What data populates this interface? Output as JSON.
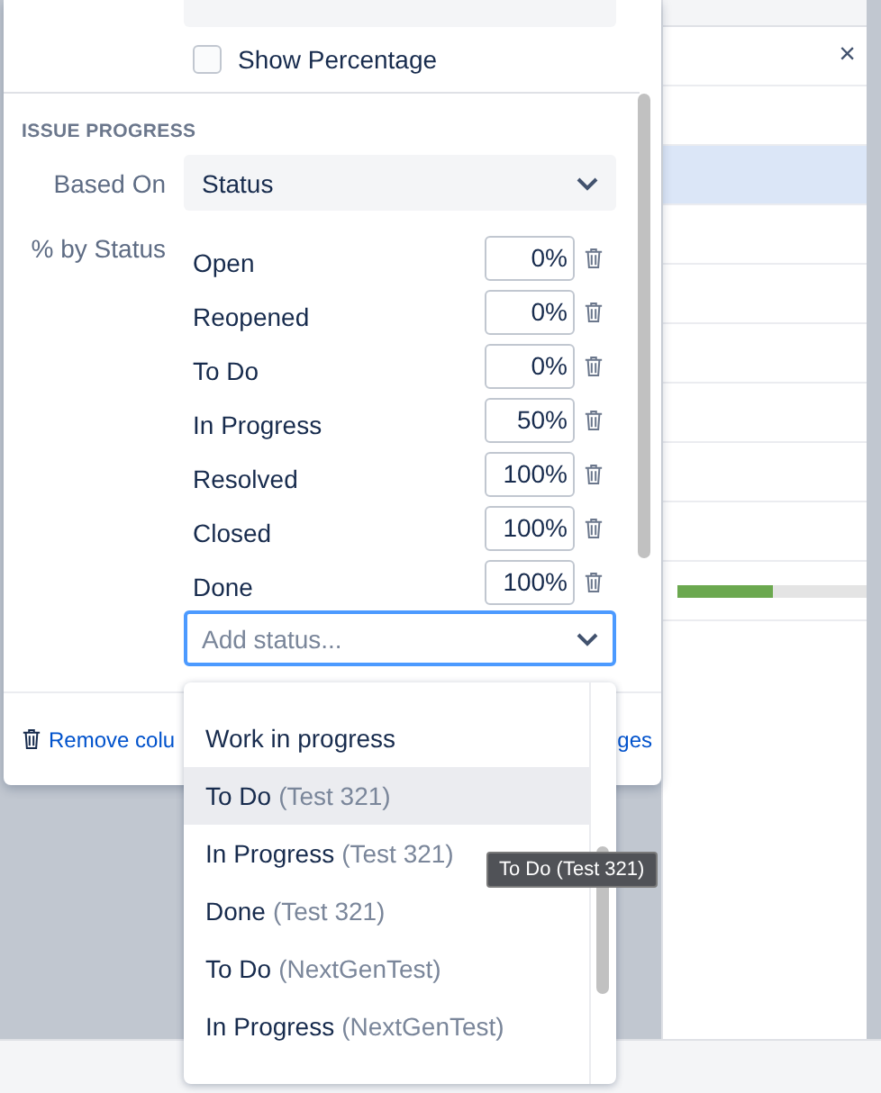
{
  "table": {
    "close_label": "×",
    "rows": [
      {
        "selected": false
      },
      {
        "selected": true
      },
      {
        "selected": false
      },
      {
        "selected": false
      },
      {
        "selected": false
      },
      {
        "selected": false
      },
      {
        "selected": false
      },
      {
        "selected": false
      },
      {
        "selected": false,
        "level": 0.5
      }
    ]
  },
  "panel": {
    "show_percentage": {
      "label": "Show Percentage",
      "checked": false
    },
    "section_title": "ISSUE PROGRESS",
    "based_on": {
      "label": "Based On",
      "value": "Status"
    },
    "by_status": {
      "label": "% by Status",
      "rows": [
        {
          "name": "Open",
          "value": "0%"
        },
        {
          "name": "Reopened",
          "value": "0%"
        },
        {
          "name": "To Do",
          "value": "0%"
        },
        {
          "name": "In Progress",
          "value": "50%"
        },
        {
          "name": "Resolved",
          "value": "100%"
        },
        {
          "name": "Closed",
          "value": "100%"
        },
        {
          "name": "Done",
          "value": "100%"
        }
      ]
    },
    "add_status": {
      "placeholder": "Add status..."
    },
    "footer": {
      "remove_text": "Remove colu",
      "right_text": "ges"
    }
  },
  "dropdown": {
    "options": [
      {
        "name": "Work in progress",
        "selected": false
      },
      {
        "name": "To Do",
        "project": "(Test 321)",
        "selected": true
      },
      {
        "name": "In Progress",
        "project": "(Test 321)",
        "selected": false
      },
      {
        "name": "Done",
        "project": "(Test 321)",
        "selected": false
      },
      {
        "name": "To Do",
        "project": "(NextGenTest)",
        "selected": false
      },
      {
        "name": "In Progress",
        "project": "(NextGenTest)",
        "selected": false
      }
    ]
  },
  "tooltip": "To Do (Test 321)"
}
